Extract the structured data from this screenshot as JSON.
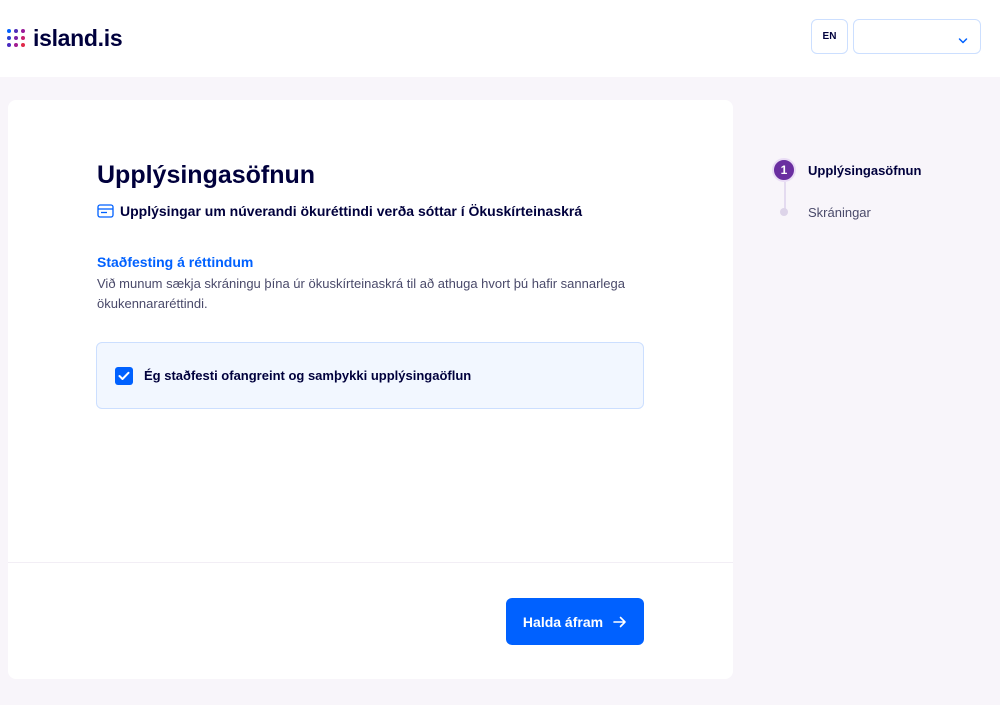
{
  "header": {
    "logo_text": "island.is",
    "language_button": "EN",
    "user_select_value": ""
  },
  "main": {
    "title": "Upplýsingasöfnun",
    "info_icon": "inbox-icon",
    "info_text": "Upplýsingar um núverandi ökuréttindi verða sóttar í Ökuskírteinaskrá",
    "section_heading": "Staðfesting á réttindum",
    "section_description": "Við munum sækja skráningu þína úr ökuskírteinaskrá til að athuga hvort þú hafir sannarlega ökukennararéttindi.",
    "confirm_label": "Ég staðfesti ofangreint og samþykki upplýsingaöflun",
    "confirm_checked": true,
    "continue_button": "Halda áfram"
  },
  "stepper": {
    "steps": [
      {
        "number": "1",
        "label": "Upplýsingasöfnun",
        "active": true
      },
      {
        "number": "",
        "label": "Skráningar",
        "active": false
      }
    ]
  },
  "colors": {
    "primary_blue": "#0061ff",
    "dark_navy": "#00003c",
    "step_purple": "#6a2ea0",
    "page_background": "#f8f5fa"
  }
}
